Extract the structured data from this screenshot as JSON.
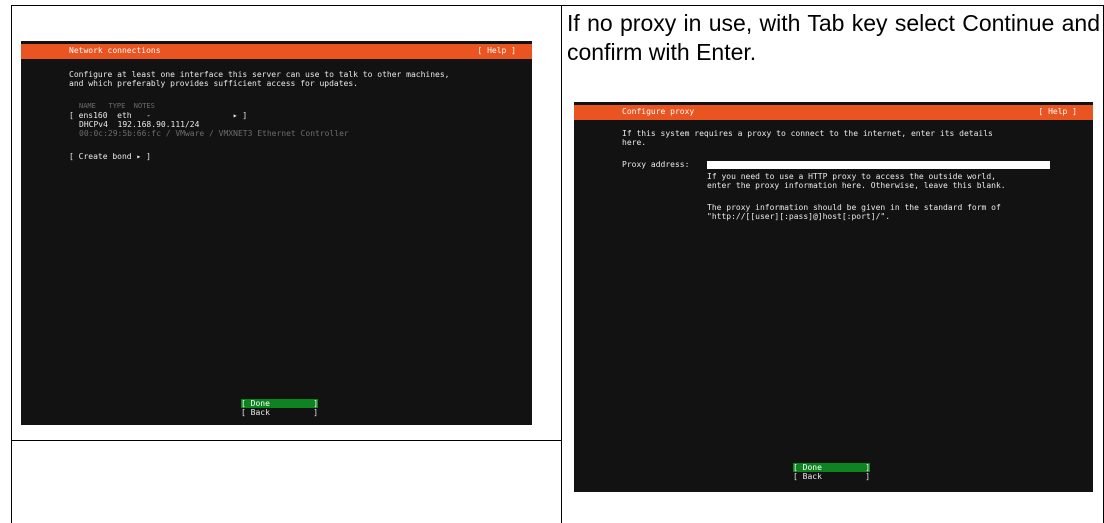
{
  "caption": "If no proxy in use, with Tab key select Continue and confirm with Enter.",
  "network_screen": {
    "title": "Network connections",
    "help": "[ Help ]",
    "intro_line1": "Configure at least one interface this server can use to talk to other machines,",
    "intro_line2": "and which preferably provides sufficient access for updates.",
    "table_header": "NAME   TYPE  NOTES",
    "iface_row": "[ ens160  eth   -                 ▸ ]",
    "dhcp_row": "DHCPv4  192.168.90.111/24",
    "mac_row": "00:0c:29:5b:66:fc / VMware / VMXNET3 Ethernet Controller",
    "create_bond": "[ Create bond ▸ ]",
    "done_button": "[ Done         ]",
    "back_button": "[ Back         ]"
  },
  "proxy_screen": {
    "title": "Configure proxy",
    "help": "[ Help ]",
    "intro_line1": "If this system requires a proxy to connect to the internet, enter its details",
    "intro_line2": "here.",
    "proxy_label": "Proxy address:",
    "proxy_value": "",
    "hint_line1": "If you need to use a HTTP proxy to access the outside world,",
    "hint_line2": "enter the proxy information here. Otherwise, leave this blank.",
    "form_line1": "The proxy information should be given in the standard form of",
    "form_line2": "\"http://[[user][:pass]@]host[:port]/\".",
    "done_button": "[ Done         ]",
    "back_button": "[ Back         ]"
  },
  "colors": {
    "header_orange": "#e95420",
    "terminal_bg": "#121212",
    "done_green": "#0e8420"
  }
}
